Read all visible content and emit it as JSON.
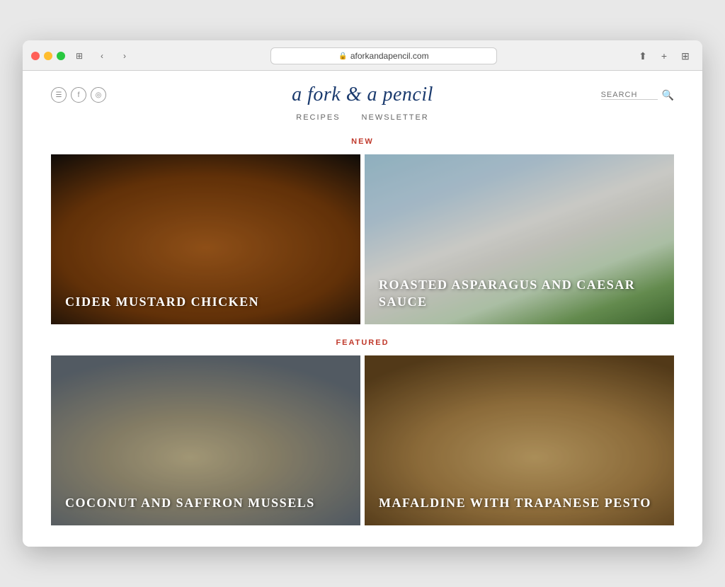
{
  "browser": {
    "url": "aforkandapencil.com",
    "tab_title": "a fork & a pencil",
    "close_tab_label": "×"
  },
  "site": {
    "title": "a fork & a pencil",
    "search_placeholder": "SEARCH",
    "nav": {
      "items": [
        {
          "label": "RECIPES",
          "href": "#"
        },
        {
          "label": "NEWSLETTER",
          "href": "#"
        }
      ]
    },
    "social": {
      "items": [
        {
          "icon": "rss",
          "label": "RSS"
        },
        {
          "icon": "facebook",
          "label": "Facebook"
        },
        {
          "icon": "instagram",
          "label": "Instagram"
        }
      ]
    }
  },
  "sections": {
    "new": {
      "label": "NEW",
      "recipes": [
        {
          "title": "CIDER MUSTARD CHICKEN",
          "image": "chicken"
        },
        {
          "title": "ROASTED ASPARAGUS AND CAESAR SAUCE",
          "image": "asparagus"
        }
      ]
    },
    "featured": {
      "label": "FEATURED",
      "recipes": [
        {
          "title": "COCONUT AND SAFFRON MUSSELS",
          "image": "mussels"
        },
        {
          "title": "MAFALDINE WITH TRAPANESE PESTO",
          "image": "pasta"
        }
      ]
    }
  }
}
